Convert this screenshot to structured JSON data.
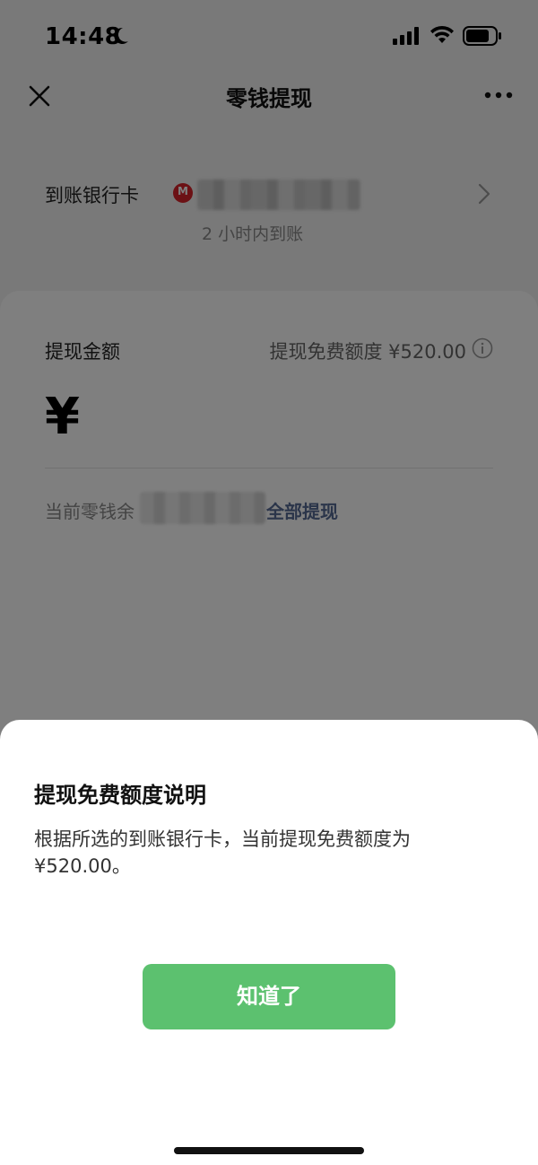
{
  "status_bar": {
    "time": "14:48",
    "icons": [
      "moon-icon",
      "signal-icon",
      "wifi-icon",
      "battery-icon"
    ]
  },
  "nav": {
    "title": "零钱提现",
    "left_icon": "close-icon",
    "right_icon": "more-icon"
  },
  "bank": {
    "label": "到账银行卡",
    "logo_text": "M",
    "arrival_note": "2 小时内到账"
  },
  "amount_card": {
    "label": "提现金额",
    "free_quota": "提现免费额度 ¥520.00",
    "currency_symbol": "¥",
    "balance_label": "当前零钱余",
    "withdraw_all": "全部提现"
  },
  "sheet": {
    "title": "提现免费额度说明",
    "body": "根据所选的到账银行卡，当前提现免费额度为¥520.00。",
    "button_label": "知道了"
  },
  "colors": {
    "button_green": "#5cc16f",
    "link_blue": "#576b95",
    "bank_red": "#d9232a"
  }
}
